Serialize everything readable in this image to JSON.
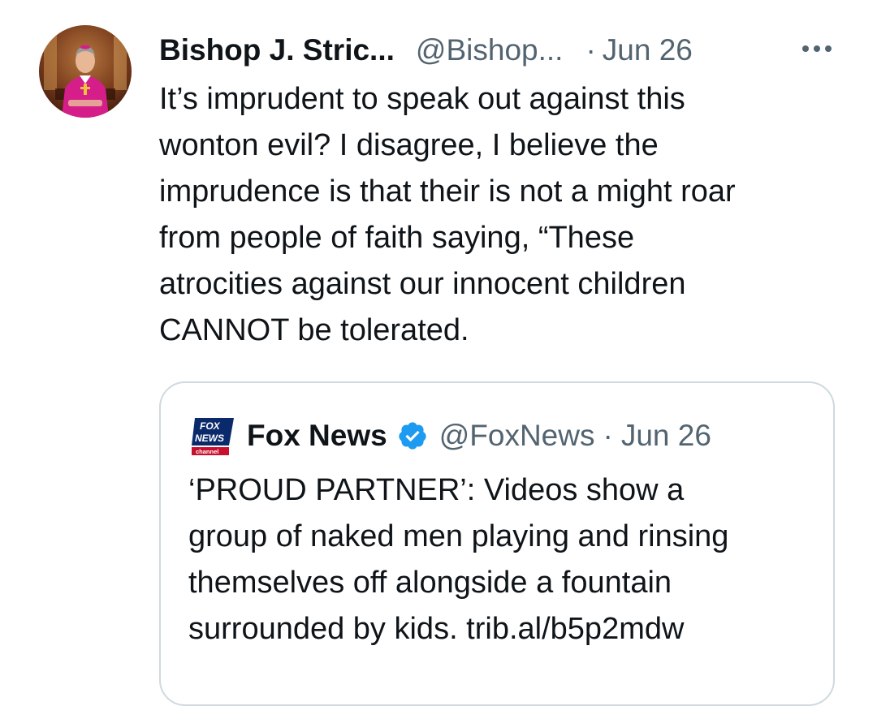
{
  "tweet": {
    "author_display_name": "Bishop J. Stric...",
    "author_handle": "@Bishop...",
    "separator": "·",
    "date": "Jun 26",
    "more_icon": "more-horizontal-icon",
    "text": "It’s imprudent to speak out against this\nwonton evil? I disagree, I believe the\nimprudence is that their is not a might roar\nfrom people of faith saying, “These\natrocities against our innocent children\nCANNOT be tolerated."
  },
  "quoted_tweet": {
    "logo": "fox-news-channel-logo",
    "logo_text": [
      "FOX",
      "NEWS",
      "channel"
    ],
    "author_display_name": "Fox News",
    "verified_icon": "verified-badge-icon",
    "author_handle": "@FoxNews",
    "separator": "·",
    "date": "Jun 26",
    "text": "‘PROUD PARTNER’: Videos show a\ngroup of naked men playing and rinsing\nthemselves off alongside a fountain\nsurrounded by kids. trib.al/b5p2mdw"
  },
  "colors": {
    "text_primary": "#0f1419",
    "text_secondary": "#536471",
    "border": "#cfd9de",
    "verified_blue": "#1d9bf0",
    "fox_blue": "#0a2a6b",
    "fox_red": "#c8102e"
  }
}
